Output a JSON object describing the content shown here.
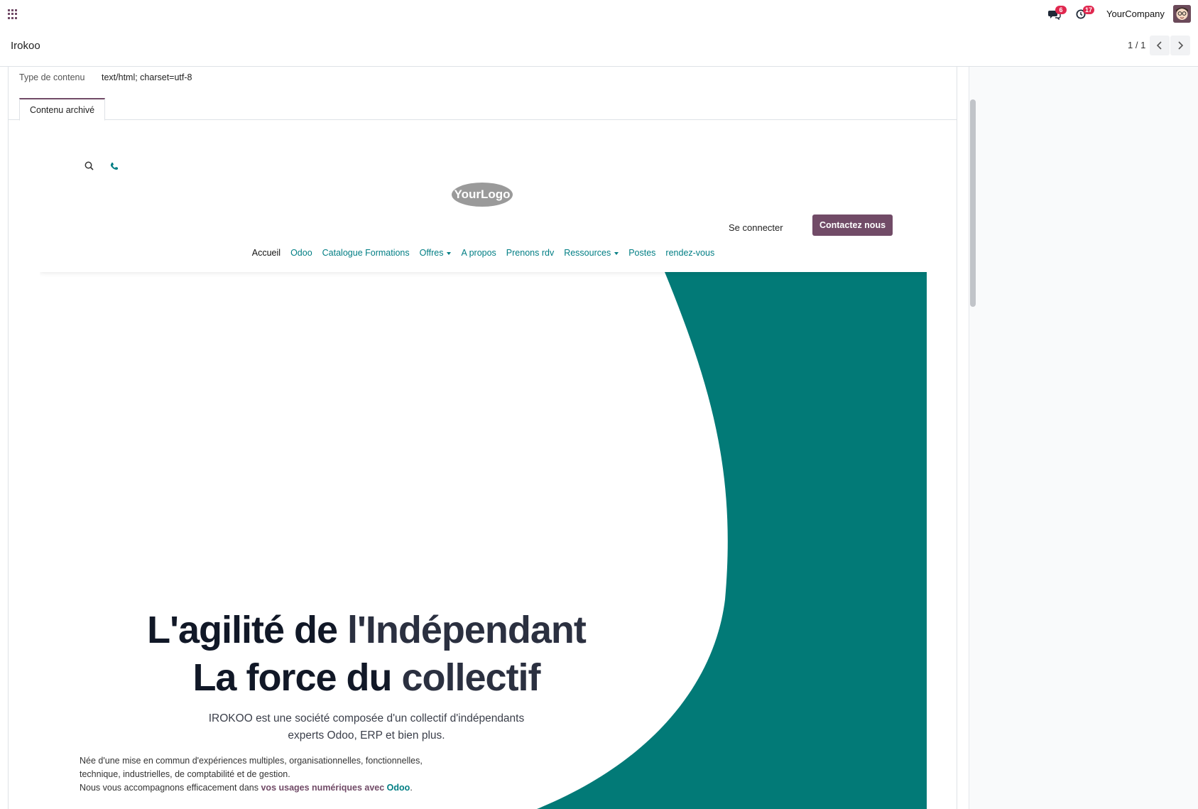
{
  "navbar": {
    "apps_icon": "apps-grid-icon",
    "messages_icon": "chat-icon",
    "messages_count": "6",
    "activities_icon": "clock-icon",
    "activities_count": "17",
    "company": "YourCompany",
    "avatar_icon": "user-avatar"
  },
  "control_panel": {
    "breadcrumb": "Irokoo",
    "pager": "1 / 1",
    "prev_icon": "chevron-left-icon",
    "next_icon": "chevron-right-icon"
  },
  "form": {
    "content_type_label": "Type de contenu",
    "content_type_value": "text/html; charset=utf-8",
    "tab_label": "Contenu archivé"
  },
  "website": {
    "search_icon": "search-icon",
    "phone_icon": "phone-icon",
    "logo_text": "YourLogo",
    "login": "Se connecter",
    "contact_button": "Contactez nous",
    "menu": [
      {
        "label": "Accueil",
        "dropdown": false,
        "active": true
      },
      {
        "label": "Odoo",
        "dropdown": false,
        "active": false
      },
      {
        "label": "Catalogue Formations",
        "dropdown": false,
        "active": false
      },
      {
        "label": "Offres",
        "dropdown": true,
        "active": false
      },
      {
        "label": "A propos",
        "dropdown": false,
        "active": false
      },
      {
        "label": "Prenons rdv",
        "dropdown": false,
        "active": false
      },
      {
        "label": "Ressources",
        "dropdown": true,
        "active": false
      },
      {
        "label": "Postes",
        "dropdown": false,
        "active": false
      },
      {
        "label": "rendez-vous",
        "dropdown": false,
        "active": false
      }
    ],
    "hero": {
      "line1_a": "L'agilité de ",
      "line1_b": "l'Indépendant",
      "line2_a": "La force du ",
      "line2_b": "collectif",
      "sub_line1": "IROKOO est une société composée d'un collectif d'indépendants",
      "sub_line2": "experts Odoo, ERP et bien plus.",
      "body_line1": "Née d'une mise en commun d'expériences multiples, organisationnelles, fonctionnelles,",
      "body_line2": "technique, industrielles, de comptabilité et de gestion.",
      "body_line3_a": "Nous vous accompagnons efficacement dans ",
      "body_line3_em": "vos usages numériques avec",
      "body_line3_space": " ",
      "body_line3_brand": "Odoo",
      "body_line3_end": "."
    }
  },
  "colors": {
    "brand": "#714b67",
    "teal": "#017e84",
    "hero_teal": "#027a77",
    "badge": "#e0284f"
  }
}
